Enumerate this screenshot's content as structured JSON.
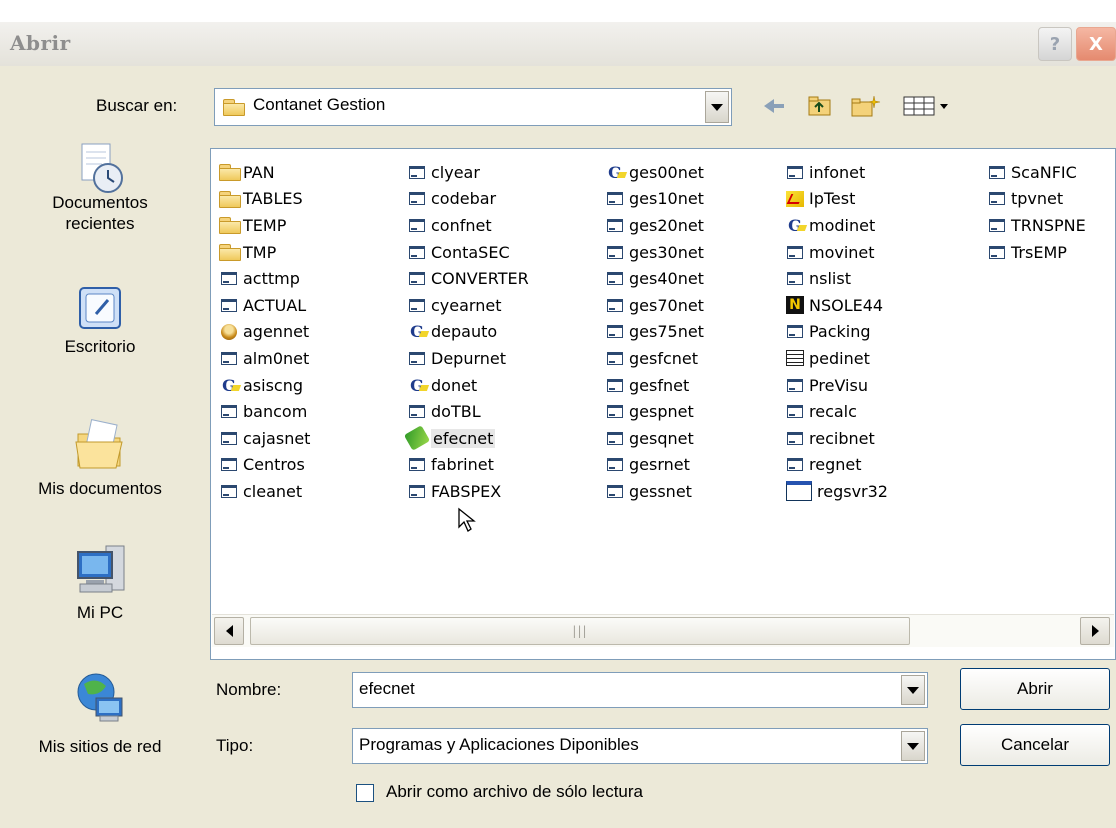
{
  "window": {
    "title": "Abrir",
    "help_button": "?",
    "close_button": "X"
  },
  "look_in": {
    "label": "Buscar en:",
    "value": "Contanet Gestion"
  },
  "places": [
    {
      "name": "recent",
      "label_line1": "Documentos",
      "label_line2": "recientes"
    },
    {
      "name": "desktop",
      "label_line1": "Escritorio",
      "label_line2": ""
    },
    {
      "name": "my-documents",
      "label_line1": "Mis documentos",
      "label_line2": ""
    },
    {
      "name": "my-computer",
      "label_line1": "Mi PC",
      "label_line2": ""
    },
    {
      "name": "network",
      "label_line1": "Mis sitios de red",
      "label_line2": ""
    }
  ],
  "files": {
    "col1": [
      "PAN",
      "TABLES",
      "TEMP",
      "TMP",
      "acttmp",
      "ACTUAL",
      "agennet",
      "alm0net",
      "asiscng",
      "bancom",
      "cajasnet",
      "Centros",
      "cleanet"
    ],
    "col2": [
      "clyear",
      "codebar",
      "confnet",
      "ContaSEC",
      "CONVERTER",
      "cyearnet",
      "depauto",
      "Depurnet",
      "donet",
      "doTBL",
      "efecnet",
      "fabrinet",
      "FABSPEX"
    ],
    "col3": [
      "ges00net",
      "ges10net",
      "ges20net",
      "ges30net",
      "ges40net",
      "ges70net",
      "ges75net",
      "gesfcnet",
      "gesfnet",
      "gespnet",
      "gesqnet",
      "gesrnet",
      "gessnet"
    ],
    "col4": [
      "infonet",
      "IpTest",
      "modinet",
      "movinet",
      "nslist",
      "NSOLE44",
      "Packing",
      "pedinet",
      "PreVisu",
      "recalc",
      "recibnet",
      "regnet",
      "regsvr32"
    ],
    "col5": [
      "ScaNFIC",
      "tpvnet",
      "TRNSPNE",
      "TrsEMP"
    ]
  },
  "filename": {
    "label": "Nombre:",
    "value": "efecnet"
  },
  "filetype": {
    "label": "Tipo:",
    "value": "Programas y Aplicaciones Diponibles"
  },
  "readonly": {
    "label": "Abrir como archivo de sólo lectura"
  },
  "buttons": {
    "open": "Abrir",
    "cancel": "Cancelar"
  }
}
